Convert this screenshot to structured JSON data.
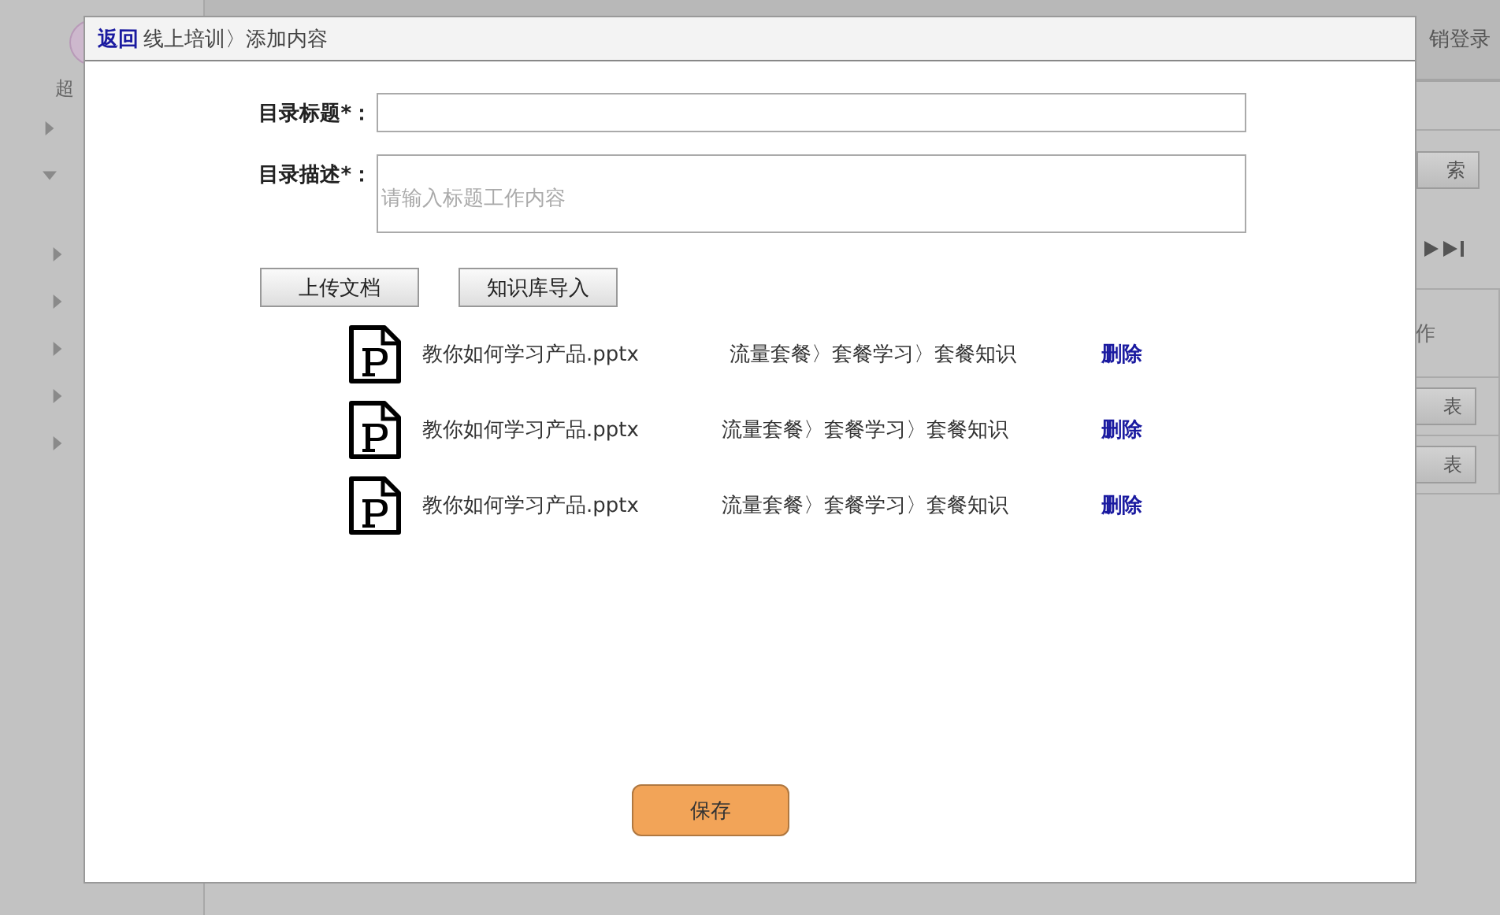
{
  "background": {
    "sidebar": {
      "user_label": "超",
      "items": [
        {
          "expanded": false
        },
        {
          "expanded": true,
          "children": [
            {
              "expanded": false
            },
            {
              "expanded": false
            },
            {
              "expanded": false
            },
            {
              "expanded": false
            },
            {
              "expanded": false
            }
          ]
        }
      ]
    },
    "logout_button": "销登录",
    "search_button": "索",
    "table_header": "作",
    "row_buttons": [
      "表",
      "表"
    ]
  },
  "dialog": {
    "back_link": "返回",
    "breadcrumb": "线上培训〉添加内容",
    "fields": [
      {
        "kind": "input",
        "label": "目录标题*："
      },
      {
        "kind": "textarea",
        "label": "目录描述*：",
        "placeholder": "请输入标题工作内容"
      }
    ],
    "buttons": [
      "上传文档",
      "知识库导入"
    ],
    "files": [
      {
        "name": "教你如何学习产品.pptx",
        "path": "流量套餐〉套餐学习〉套餐知识",
        "action": "删除"
      },
      {
        "name": "教你如何学习产品.pptx",
        "path": "流量套餐〉套餐学习〉套餐知识",
        "action": "删除"
      },
      {
        "name": "教你如何学习产品.pptx",
        "path": "流量套餐〉套餐学习〉套餐知识",
        "action": "删除"
      }
    ],
    "save_button": "保存"
  }
}
